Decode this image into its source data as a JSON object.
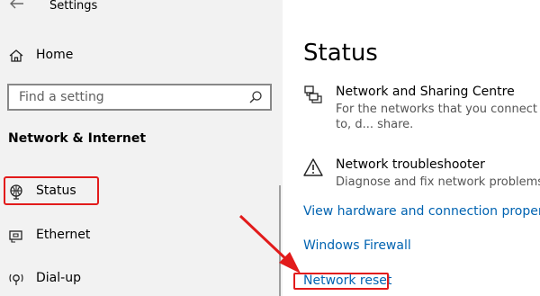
{
  "window": {
    "title": "Settings"
  },
  "sidebar": {
    "home_label": "Home",
    "search_placeholder": "Find a setting",
    "section_heading": "Network & Internet",
    "items": [
      {
        "label": "Status",
        "icon": "globe-icon"
      },
      {
        "label": "Ethernet",
        "icon": "ethernet-icon"
      },
      {
        "label": "Dial-up",
        "icon": "dialup-icon"
      }
    ]
  },
  "main": {
    "title": "Status",
    "sharing": {
      "title": "Network and Sharing Centre",
      "description": "For the networks that you connect to, d... share."
    },
    "troubleshooter": {
      "title": "Network troubleshooter",
      "description": "Diagnose and fix network problems."
    },
    "links": {
      "hardware": "View hardware and connection properties",
      "firewall": "Windows Firewall",
      "reset": "Network reset"
    }
  },
  "colors": {
    "accent_link": "#0063b1",
    "highlight": "#e21b1b",
    "sidebar_bg": "#f2f2f2"
  }
}
